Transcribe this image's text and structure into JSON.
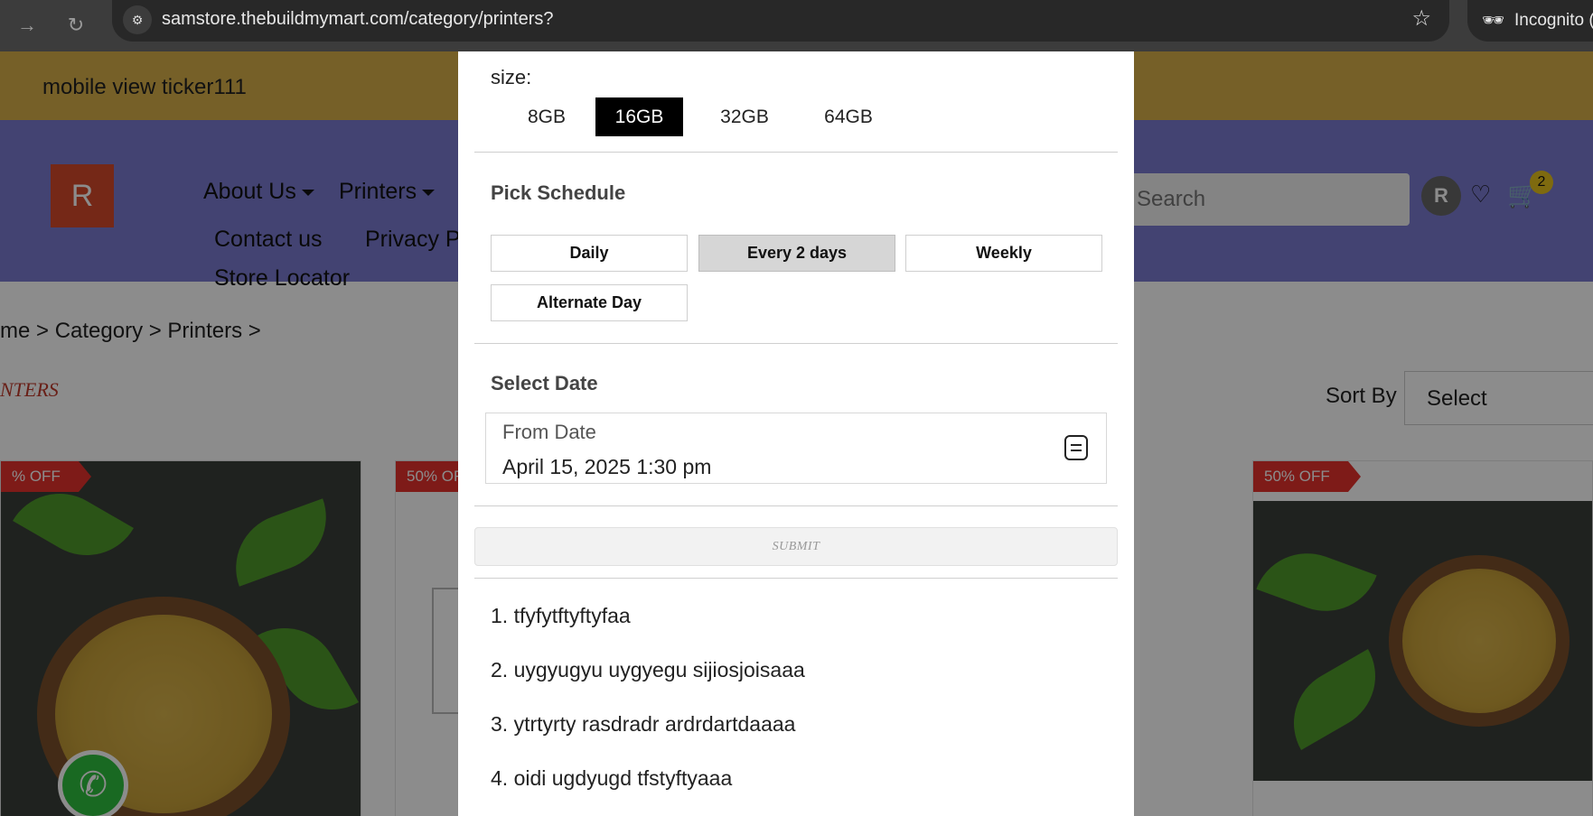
{
  "browser": {
    "url": "samstore.thebuildmymart.com/category/printers?",
    "incognito_label": "Incognito ("
  },
  "ticker": {
    "text": "mobile view ticker111"
  },
  "header": {
    "logo_letter": "R",
    "menu": {
      "about": "About Us",
      "printers": "Printers",
      "contact": "Contact us",
      "privacy": "Privacy P",
      "store_locator": "Store Locator"
    },
    "search_placeholder": "Search",
    "avatar_letter": "R",
    "cart_count": "2"
  },
  "breadcrumb": "me > Category > Printers >",
  "category_title": "NTERS",
  "sort": {
    "label": "Sort By",
    "value": "Select"
  },
  "products": {
    "badge_1": "% OFF",
    "badge_2": "50% OF",
    "badge_3": "50% OFF"
  },
  "modal": {
    "size_label": "size:",
    "sizes": [
      "8GB",
      "16GB",
      "32GB",
      "64GB"
    ],
    "selected_size": "16GB",
    "schedule_title": "Pick Schedule",
    "schedule_options": [
      "Daily",
      "Every 2 days",
      "Weekly",
      "Alternate Day"
    ],
    "selected_schedule": "Every 2 days",
    "date_title": "Select Date",
    "from_label": "From Date",
    "from_value": "April 15, 2025 1:30 pm",
    "submit_label": "SUBMIT",
    "items": [
      "1. tfyfytftyftyfaa",
      "2. uygyugyu uygyegu sijiosjoisaaa",
      "3. ytrtyrty rasdradr ardrdartdaaaa",
      "4. oidi ugdyugd tfstyftyaaa"
    ]
  },
  "colors": {
    "ticker_bg": "#d8b04a",
    "header_bg": "#7b7bd0",
    "logo_bg": "#d64a2a",
    "badge_red": "#e5322d",
    "active_size_bg": "#000000",
    "active_schedule_bg": "#d6d6d6"
  }
}
